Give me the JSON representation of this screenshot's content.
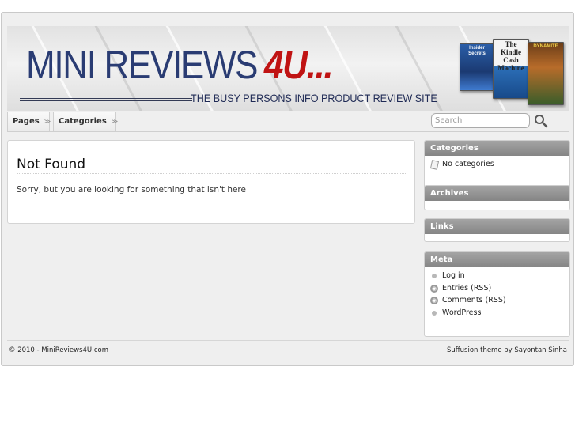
{
  "header": {
    "site_title_main": "MINI REVIEWS",
    "site_title_accent": "4U...",
    "tagline": "THE BUSY PERSONS INFO PRODUCT REVIEW SITE",
    "books": [
      "Insider Secrets",
      "The Kindle Cash Machine",
      "DYNAMITE"
    ]
  },
  "nav": {
    "tabs": [
      {
        "label": "Pages"
      },
      {
        "label": "Categories"
      }
    ],
    "search_placeholder": "Search"
  },
  "post": {
    "title": "Not Found",
    "body": "Sorry, but you are looking for something that isn't here"
  },
  "sidebar": {
    "categories": {
      "title": "Categories",
      "items": [
        "No categories"
      ]
    },
    "archives": {
      "title": "Archives"
    },
    "links": {
      "title": "Links"
    },
    "meta": {
      "title": "Meta",
      "items": [
        "Log in",
        "Entries (RSS)",
        "Comments (RSS)",
        "WordPress"
      ]
    }
  },
  "footer": {
    "copyright": "© 2010 - MiniReviews4U.com",
    "credit": "Suffusion theme by Sayontan Sinha"
  },
  "colors": {
    "title_blue": "#2a3c73",
    "accent_red": "#c01313",
    "widget_header": "#8f8f8f",
    "page_bg": "#efefef"
  }
}
